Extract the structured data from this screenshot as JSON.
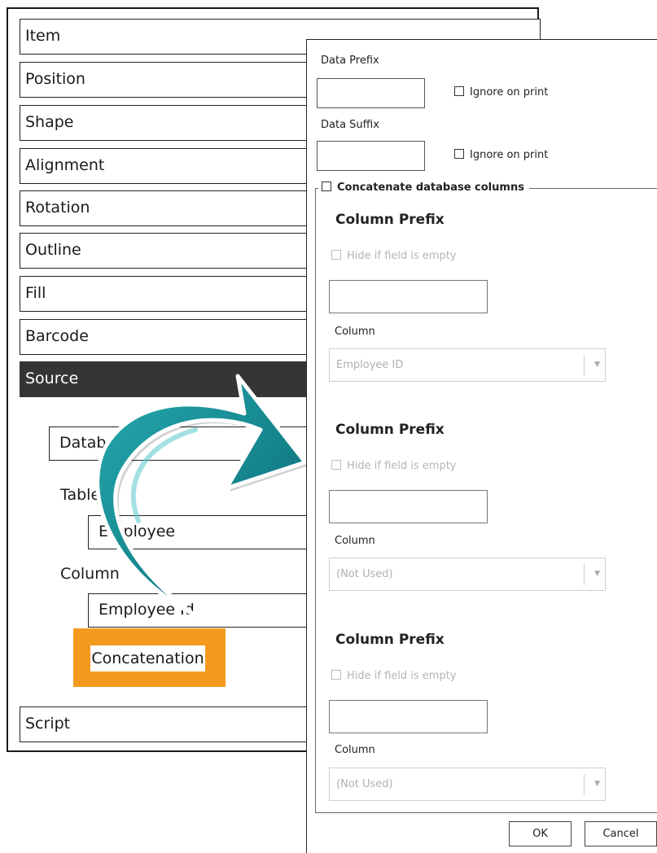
{
  "left_panel": {
    "sections": [
      "Item",
      "Position",
      "Shape",
      "Alignment",
      "Rotation",
      "Outline",
      "Fill",
      "Barcode",
      "Source"
    ],
    "active_section": "Source",
    "source": {
      "database_value": "Database",
      "table_label": "Table",
      "table_value": "Employee",
      "column_label": "Column",
      "column_value": "Employee Id",
      "concatenation_button": "Concatenation"
    },
    "script_section": "Script"
  },
  "dialog": {
    "data_prefix_label": "Data Prefix",
    "data_prefix_value": "",
    "data_prefix_ignore": "Ignore on print",
    "data_suffix_label": "Data Suffix",
    "data_suffix_value": "",
    "data_suffix_ignore": "Ignore on print",
    "concatenate_label": "Concatenate database columns",
    "groups": [
      {
        "title": "Column Prefix",
        "hide_label": "Hide if field is empty",
        "column_label": "Column",
        "column_value": "Employee ID"
      },
      {
        "title": "Column Prefix",
        "hide_label": "Hide if field is empty",
        "column_label": "Column",
        "column_value": "(Not Used)"
      },
      {
        "title": "Column Prefix",
        "hide_label": "Hide if field is empty",
        "column_label": "Column",
        "column_value": "(Not Used)"
      }
    ],
    "ok_label": "OK",
    "cancel_label": "Cancel"
  },
  "colors": {
    "active_section_bg": "#353535",
    "highlight_orange": "#f39a1e",
    "arrow_teal": "#17868e"
  },
  "icons": [
    "curved-arrow-icon",
    "checkbox-icon",
    "dropdown-arrow-icon"
  ]
}
